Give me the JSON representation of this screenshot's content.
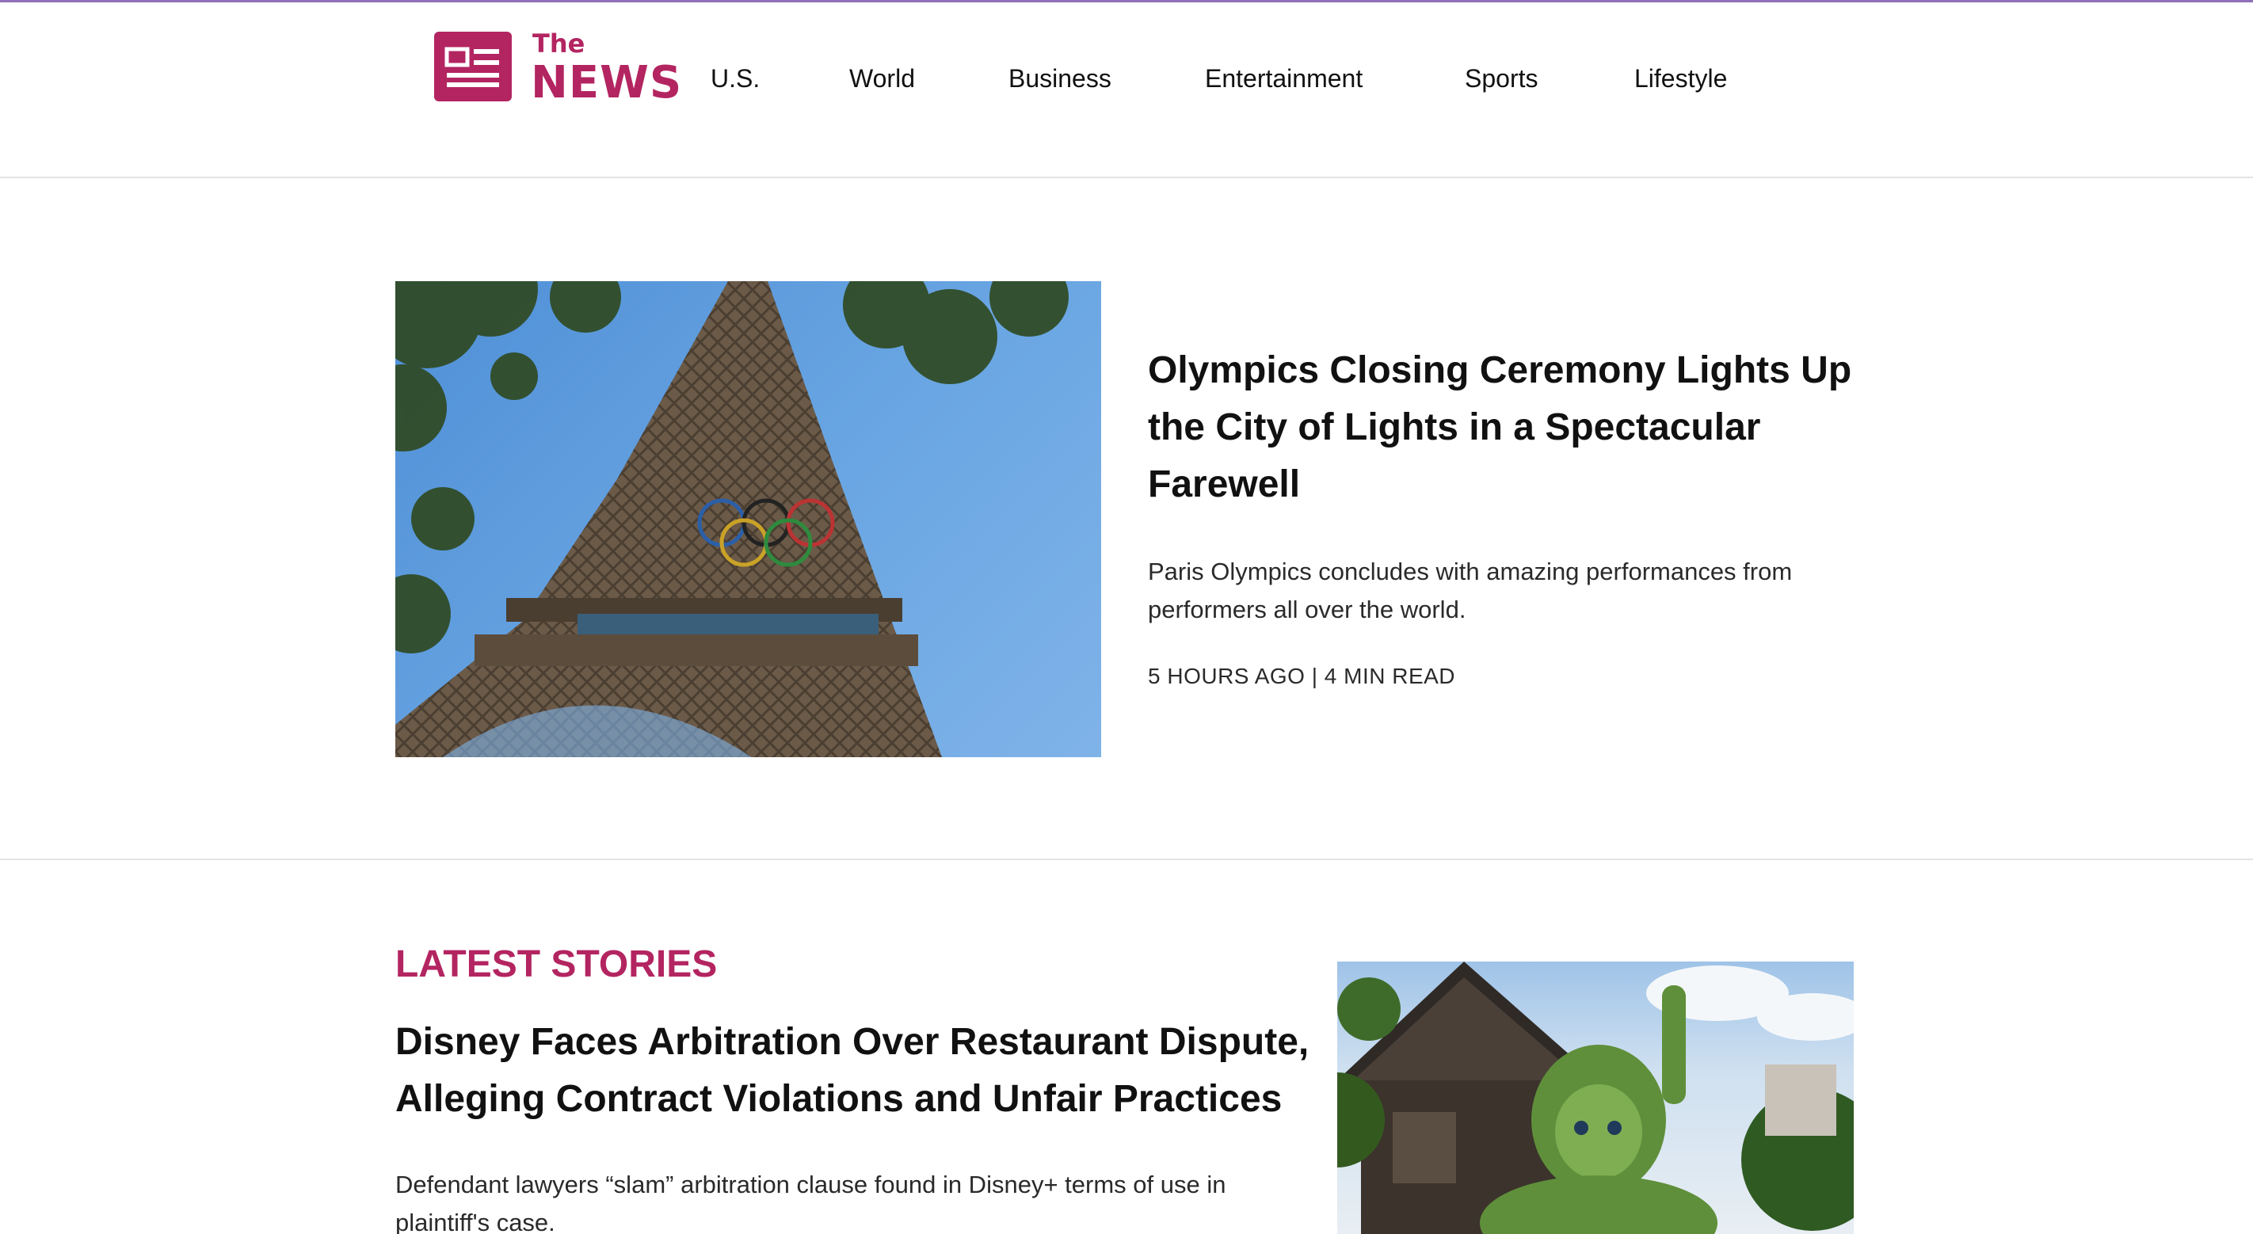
{
  "brand": {
    "the": "The",
    "news": "NEWS",
    "color": "#b32561"
  },
  "nav": {
    "items": [
      "U.S.",
      "World",
      "Business",
      "Entertainment",
      "Sports",
      "Lifestyle"
    ]
  },
  "hero": {
    "image_icon": "eiffel-tower-olympic-rings-photo",
    "title": "Olympics Closing Ceremony Lights Up the City of Lights in a Spectacular Farewell",
    "description": "Paris Olympics concludes with amazing performances from performers all over the world.",
    "meta": "5 HOURS AGO | 4 MIN READ"
  },
  "latest": {
    "section_title": "LATEST STORIES",
    "story": {
      "title": "Disney Faces Arbitration Over Restaurant Dispute, Alleging Contract Violations and Unfair Practices",
      "description": "Defendant lawyers “slam” arbitration clause found in Disney+ terms of use in plaintiff's case.",
      "image_icon": "topiary-character-photo"
    }
  },
  "colors": {
    "accent": "#b32561",
    "top_line": "#8e6fb8",
    "divider": "#e3e3e3"
  }
}
